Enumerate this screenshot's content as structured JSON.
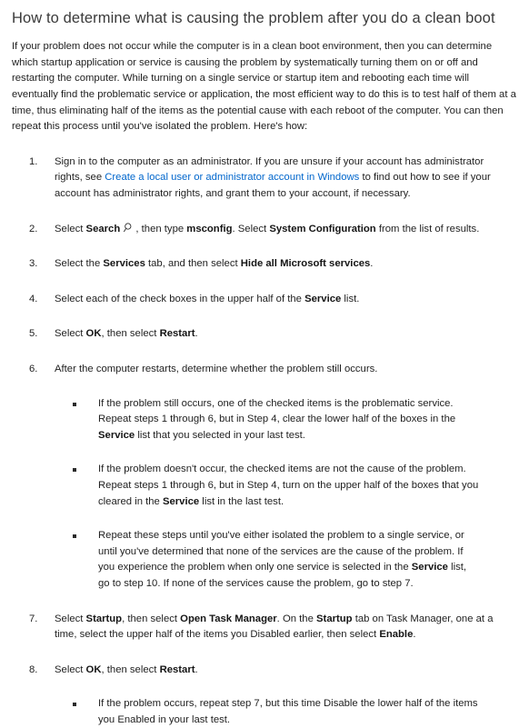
{
  "heading": "How to determine what is causing the problem after you do a clean boot",
  "intro": "If your problem does not occur while the computer is in a clean boot environment, then you can determine which startup application or service is causing the problem by systematically turning them on or off and restarting the computer. While turning on a single service or startup item and rebooting each time will eventually find the problematic service or application, the most efficient way to do this is to test half of them at a time, thus eliminating half of the items as the potential cause with each reboot of the computer. You can then repeat this process until you've isolated the problem. Here's how:",
  "colors": {
    "link": "#0066cc",
    "heading": "#3a3a3a",
    "body": "#1f1f1f",
    "background": "#ffffff"
  },
  "steps": [
    {
      "number": "1.",
      "parts": [
        {
          "type": "text",
          "value": "Sign in to the computer as an administrator. If you are unsure if your account has administrator rights, see "
        },
        {
          "type": "link",
          "value": "Create a local user or administrator account in Windows"
        },
        {
          "type": "text",
          "value": " to find out how to see if your account has administrator rights, and grant them to your account, if necessary."
        }
      ]
    },
    {
      "number": "2.",
      "parts": [
        {
          "type": "text",
          "value": "Select "
        },
        {
          "type": "bold",
          "value": "Search"
        },
        {
          "type": "text",
          "value": " "
        },
        {
          "type": "icon",
          "value": "search-icon"
        },
        {
          "type": "text",
          "value": ", then type "
        },
        {
          "type": "bold",
          "value": "msconfig"
        },
        {
          "type": "text",
          "value": ". Select "
        },
        {
          "type": "bold",
          "value": "System Configuration"
        },
        {
          "type": "text",
          "value": " from the list of results."
        }
      ]
    },
    {
      "number": "3.",
      "parts": [
        {
          "type": "text",
          "value": "Select the "
        },
        {
          "type": "bold",
          "value": "Services"
        },
        {
          "type": "text",
          "value": " tab, and then select "
        },
        {
          "type": "bold",
          "value": "Hide all Microsoft services"
        },
        {
          "type": "text",
          "value": "."
        }
      ]
    },
    {
      "number": "4.",
      "parts": [
        {
          "type": "text",
          "value": "Select each of the check boxes in the upper half of the "
        },
        {
          "type": "bold",
          "value": "Service"
        },
        {
          "type": "text",
          "value": " list."
        }
      ]
    },
    {
      "number": "5.",
      "parts": [
        {
          "type": "text",
          "value": "Select "
        },
        {
          "type": "bold",
          "value": "OK"
        },
        {
          "type": "text",
          "value": ", then select "
        },
        {
          "type": "bold",
          "value": "Restart"
        },
        {
          "type": "text",
          "value": "."
        }
      ]
    },
    {
      "number": "6.",
      "parts": [
        {
          "type": "text",
          "value": "After the computer restarts, determine whether the problem still occurs."
        }
      ],
      "subs": [
        {
          "parts": [
            {
              "type": "text",
              "value": "If the problem still occurs, one of the checked items is the problematic service. Repeat steps 1 through 6, but in Step 4, clear the lower half of the boxes in the "
            },
            {
              "type": "bold",
              "value": "Service"
            },
            {
              "type": "text",
              "value": " list that you selected in your last test."
            }
          ]
        },
        {
          "parts": [
            {
              "type": "text",
              "value": "If the problem doesn't occur, the checked items are not the cause of the problem. Repeat steps 1 through 6, but in Step 4, turn on the upper half of the boxes that you cleared in the "
            },
            {
              "type": "bold",
              "value": "Service"
            },
            {
              "type": "text",
              "value": " list in the last test."
            }
          ]
        },
        {
          "parts": [
            {
              "type": "text",
              "value": "Repeat these steps until you've either isolated the problem to a single service, or until you've determined that none of the services are the cause of the problem. If you experience the problem when only one service is selected in the "
            },
            {
              "type": "bold",
              "value": "Service"
            },
            {
              "type": "text",
              "value": " list, go to step 10. If none of the services cause the problem, go to step 7."
            }
          ]
        }
      ]
    },
    {
      "number": "7.",
      "parts": [
        {
          "type": "text",
          "value": "Select "
        },
        {
          "type": "bold",
          "value": "Startup"
        },
        {
          "type": "text",
          "value": ", then select "
        },
        {
          "type": "bold",
          "value": "Open Task Manager"
        },
        {
          "type": "text",
          "value": ". On the "
        },
        {
          "type": "bold",
          "value": "Startup"
        },
        {
          "type": "text",
          "value": " tab on Task Manager, one at a time, select the upper half of the items you Disabled earlier, then select "
        },
        {
          "type": "bold",
          "value": "Enable"
        },
        {
          "type": "text",
          "value": "."
        }
      ]
    },
    {
      "number": "8.",
      "parts": [
        {
          "type": "text",
          "value": "Select "
        },
        {
          "type": "bold",
          "value": "OK"
        },
        {
          "type": "text",
          "value": ", then select "
        },
        {
          "type": "bold",
          "value": "Restart"
        },
        {
          "type": "text",
          "value": "."
        }
      ],
      "subs": [
        {
          "parts": [
            {
              "type": "text",
              "value": "If the problem occurs, repeat step 7, but this time Disable the lower half of the items you Enabled in your last test."
            }
          ]
        }
      ]
    }
  ]
}
